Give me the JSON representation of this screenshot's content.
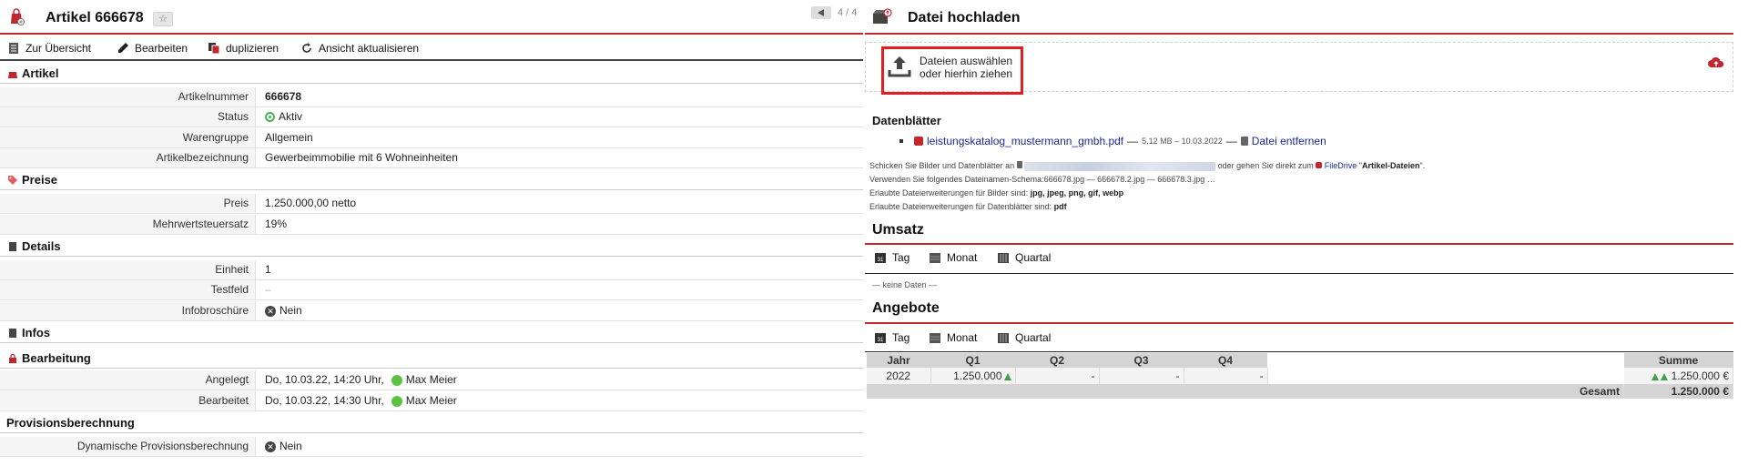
{
  "left": {
    "title": "Artikel 666678",
    "pager": "4 / 4",
    "toolbar": {
      "overview": "Zur Übersicht",
      "edit": "Bearbeiten",
      "duplicate": "duplizieren",
      "refresh": "Ansicht aktualisieren"
    },
    "sections": {
      "artikel": "Artikel",
      "preise": "Preise",
      "details": "Details",
      "infos": "Infos",
      "bearbeitung": "Bearbeitung",
      "provision": "Provisionsberechnung"
    },
    "rows": {
      "artikelnummer": {
        "label": "Artikelnummer",
        "value": "666678"
      },
      "status": {
        "label": "Status",
        "value": "Aktiv"
      },
      "warengruppe": {
        "label": "Warengruppe",
        "value": "Allgemein"
      },
      "bezeichnung": {
        "label": "Artikelbezeichnung",
        "value": "Gewerbeimmobilie mit 6 Wohneinheiten"
      },
      "preis": {
        "label": "Preis",
        "value": "1.250.000,00 netto"
      },
      "mwst": {
        "label": "Mehrwertsteuersatz",
        "value": "19%"
      },
      "einheit": {
        "label": "Einheit",
        "value": "1"
      },
      "testfeld": {
        "label": "Testfeld",
        "value": "–"
      },
      "infobroschuere": {
        "label": "Infobroschüre",
        "value": "Nein"
      },
      "angelegt": {
        "label": "Angelegt",
        "value": "Do, 10.03.22, 14:20 Uhr,",
        "user": "Max Meier"
      },
      "bearbeitet": {
        "label": "Bearbeitet",
        "value": "Do, 10.03.22, 14:30 Uhr,",
        "user": "Max Meier"
      },
      "dynprov": {
        "label": "Dynamische Provisionsberechnung",
        "value": "Nein"
      }
    }
  },
  "right": {
    "title": "Datei hochladen",
    "drop_line1": "Dateien auswählen",
    "drop_line2": "oder hierhin ziehen",
    "datenblaetter": "Datenblätter",
    "file_name": "leistungskatalog_mustermann_gmbh.pdf",
    "file_sep1": "—",
    "file_meta": "5,12 MB – 10.03.2022",
    "file_sep2": "—",
    "file_remove": "Datei entfernen",
    "info1_pre": "Schicken Sie Bilder und Datenblätter an",
    "info1_post": "oder gehen Sie direkt zum",
    "info1_link_pre": "FileDrive \"",
    "info1_link": "Artikel-Dateien",
    "info1_link_post": "\".",
    "info2": "Verwenden Sie folgendes Dateinamen-Schema:666678.jpg — 666678.2.jpg — 666678.3.jpg …",
    "info3_pre": "Erlaubte Dateierweiterungen für Bilder sind:",
    "info3_val": "jpg, jpeg, png, gif, webp",
    "info4_pre": "Erlaubte Dateierweiterungen für Datenblätter sind:",
    "info4_val": "pdf",
    "umsatz": "Umsatz",
    "angebote": "Angebote",
    "periods": {
      "tag": "Tag",
      "monat": "Monat",
      "quartal": "Quartal"
    },
    "no_data": "— keine Daten —",
    "table": {
      "headers": {
        "jahr": "Jahr",
        "q1": "Q1",
        "q2": "Q2",
        "q3": "Q3",
        "q4": "Q4",
        "summe": "Summe"
      },
      "row": {
        "jahr": "2022",
        "q1": "1.250.000",
        "q2": "-",
        "q3": "-",
        "q4": "-",
        "summe": "1.250.000 €"
      },
      "total_label": "Gesamt",
      "total_value": "1.250.000 €"
    }
  }
}
